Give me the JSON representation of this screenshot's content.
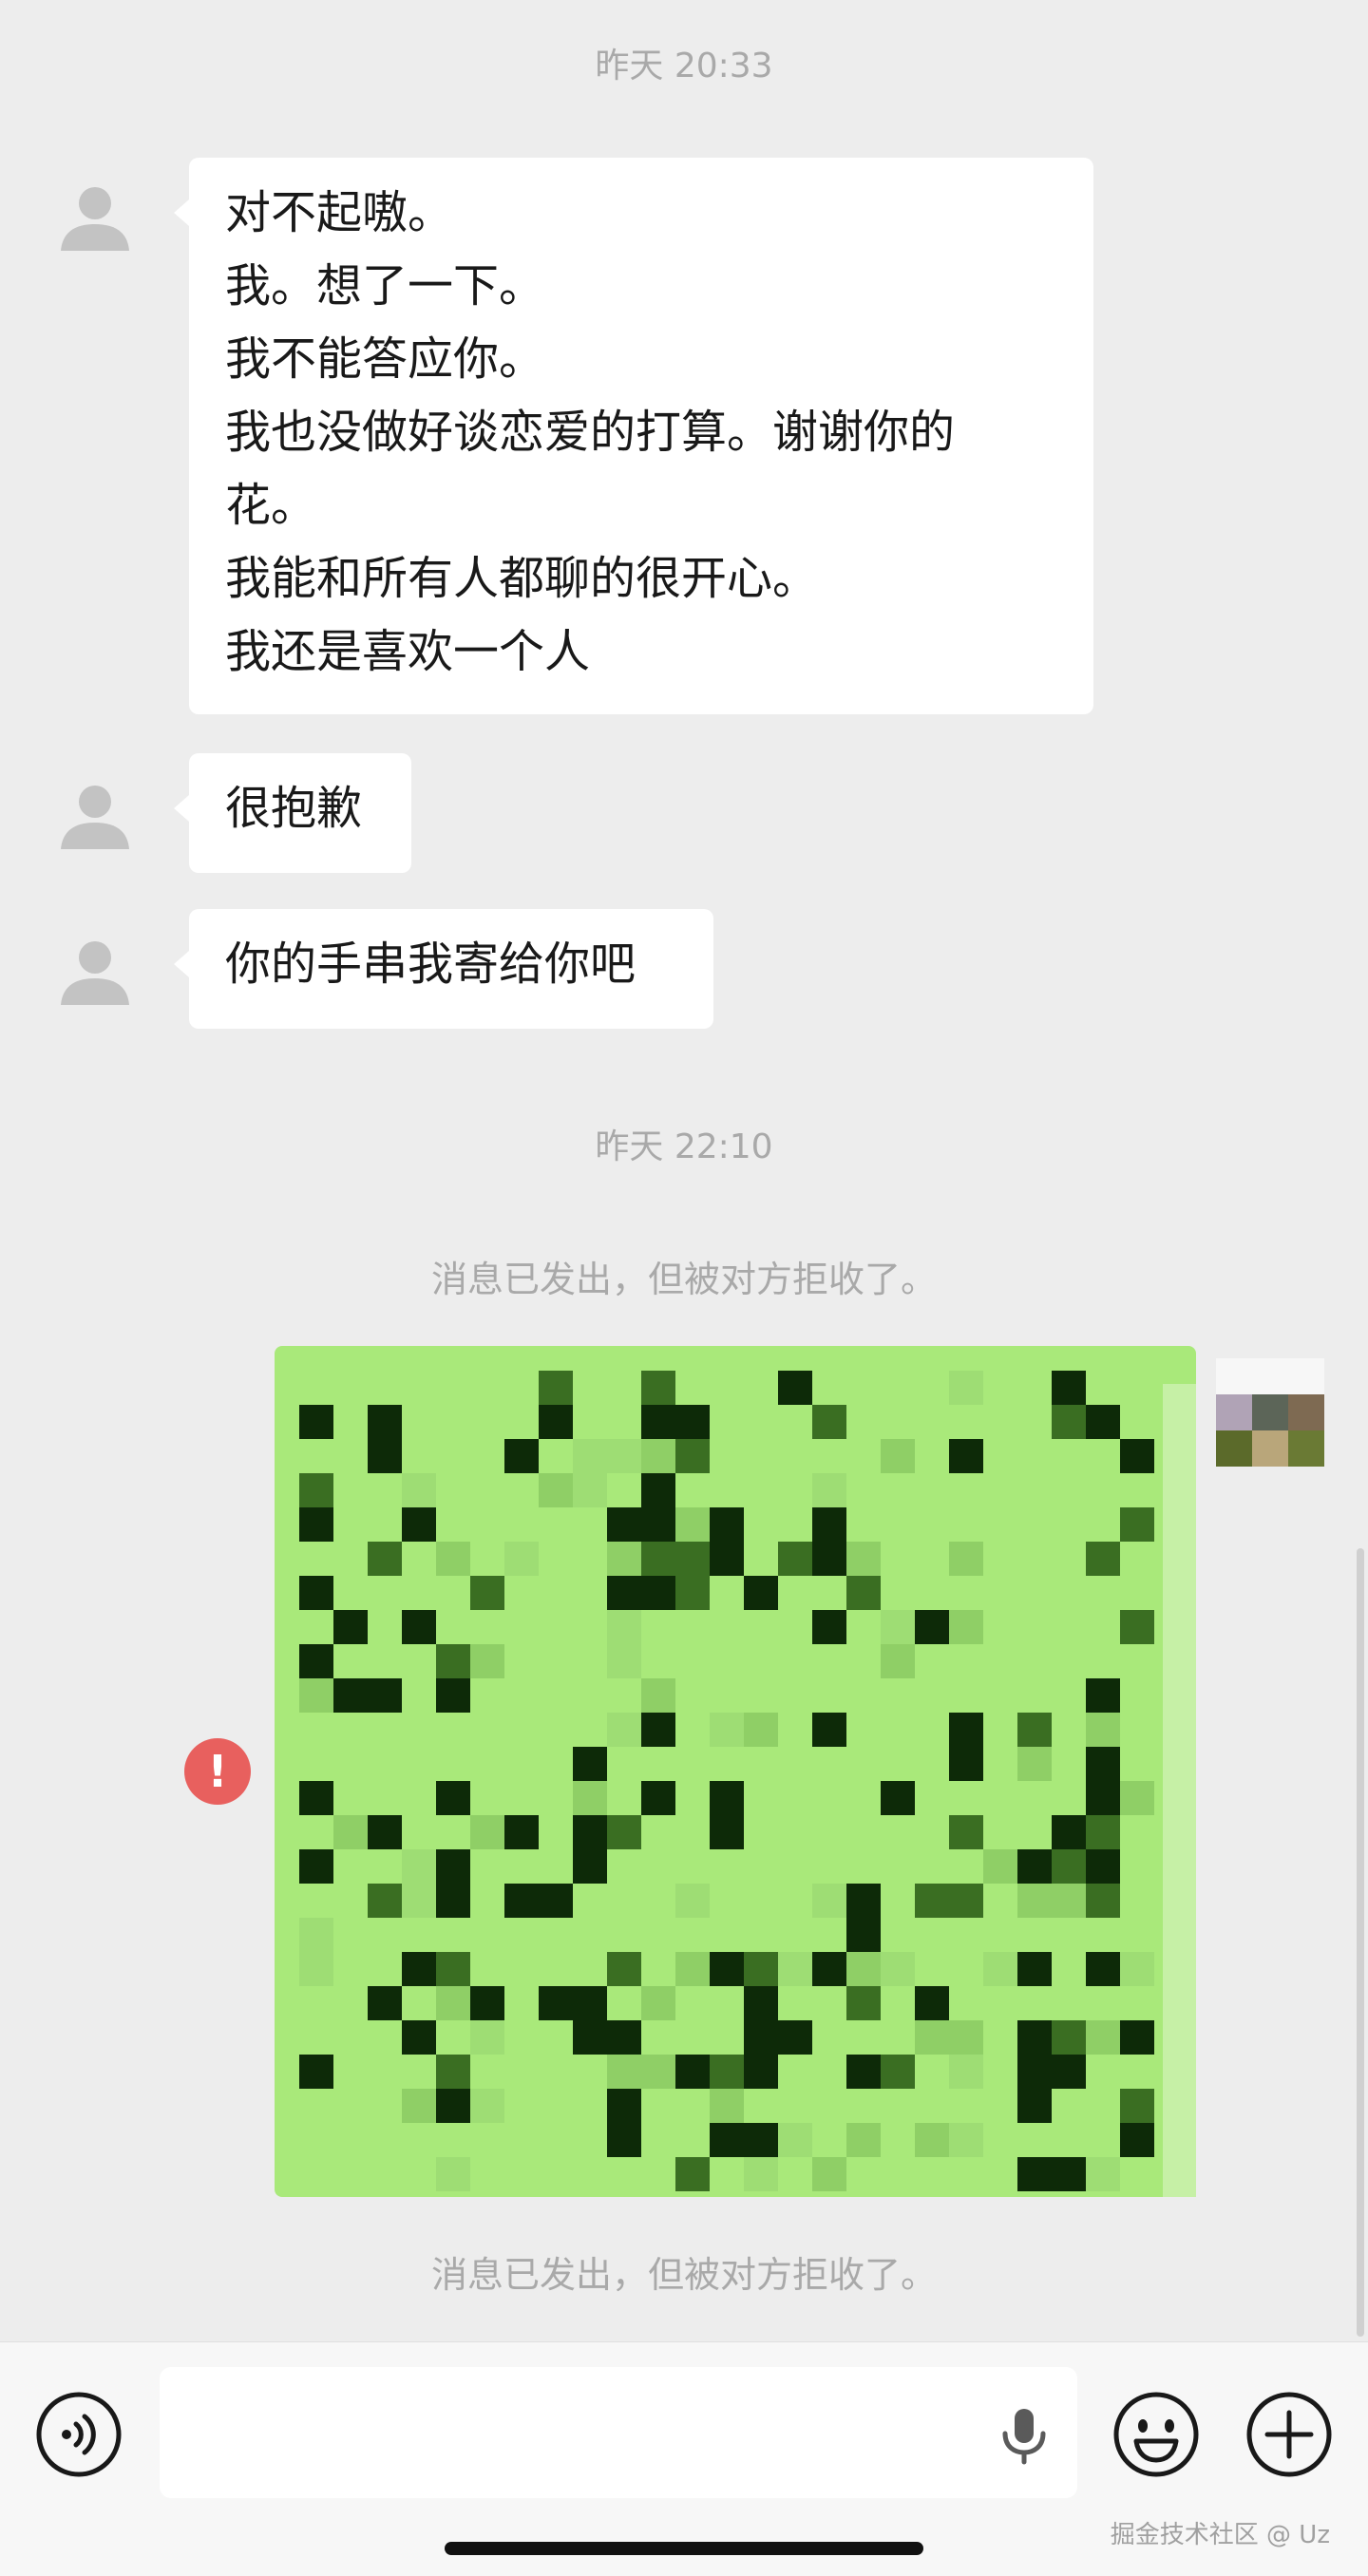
{
  "timestamps": [
    "昨天 20:33",
    "昨天 22:10"
  ],
  "messages": [
    {
      "lines": [
        "对不起嗷。",
        "我。想了一下。",
        "我不能答应你。",
        "我也没做好谈恋爱的打算。谢谢你的",
        "花。",
        "我能和所有人都聊的很开心。",
        "我还是喜欢一个人"
      ]
    },
    {
      "lines": [
        "很抱歉"
      ]
    },
    {
      "lines": [
        "你的手串我寄给你吧"
      ]
    }
  ],
  "system_notes": [
    "消息已发出，但被对方拒收了。",
    "消息已发出，但被对方拒收了。"
  ],
  "error_badge": "!",
  "input_bar": {
    "placeholder": "",
    "voice_icon": "voice-icon",
    "mic_icon": "microphone-icon",
    "emoji_icon": "emoji-icon",
    "plus_icon": "plus-icon"
  },
  "watermark": "掘金技术社区 @ Uz",
  "colors": {
    "background": "#ededed",
    "bubble_received": "#ffffff",
    "bubble_sent": "#a9e97a",
    "error": "#e8605e",
    "meta_text": "#a9a9a9"
  }
}
